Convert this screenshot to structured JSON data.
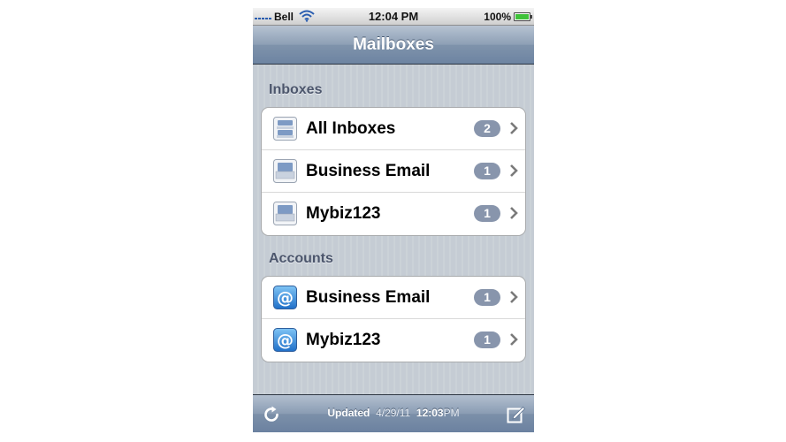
{
  "status_bar": {
    "carrier": "Bell",
    "time": "12:04 PM",
    "battery": "100%"
  },
  "nav": {
    "title": "Mailboxes"
  },
  "inboxes": {
    "header": "Inboxes",
    "items": [
      {
        "label": "All Inboxes",
        "count": "2",
        "icon": "stacked-inbox-icon"
      },
      {
        "label": "Business Email",
        "count": "1",
        "icon": "inbox-icon"
      },
      {
        "label": "Mybiz123",
        "count": "1",
        "icon": "inbox-icon"
      }
    ]
  },
  "accounts": {
    "header": "Accounts",
    "items": [
      {
        "label": "Business Email",
        "count": "1",
        "icon": "at-sign-icon"
      },
      {
        "label": "Mybiz123",
        "count": "1",
        "icon": "at-sign-icon"
      }
    ]
  },
  "toolbar": {
    "updated_label": "Updated",
    "updated_date": "4/29/11",
    "updated_time": "12:03",
    "updated_ampm": "PM"
  },
  "colors": {
    "badge": "#8895ac",
    "nav_bar": "#6d84a2",
    "background": "#c5ccd4",
    "battery": "#3fc23a"
  }
}
